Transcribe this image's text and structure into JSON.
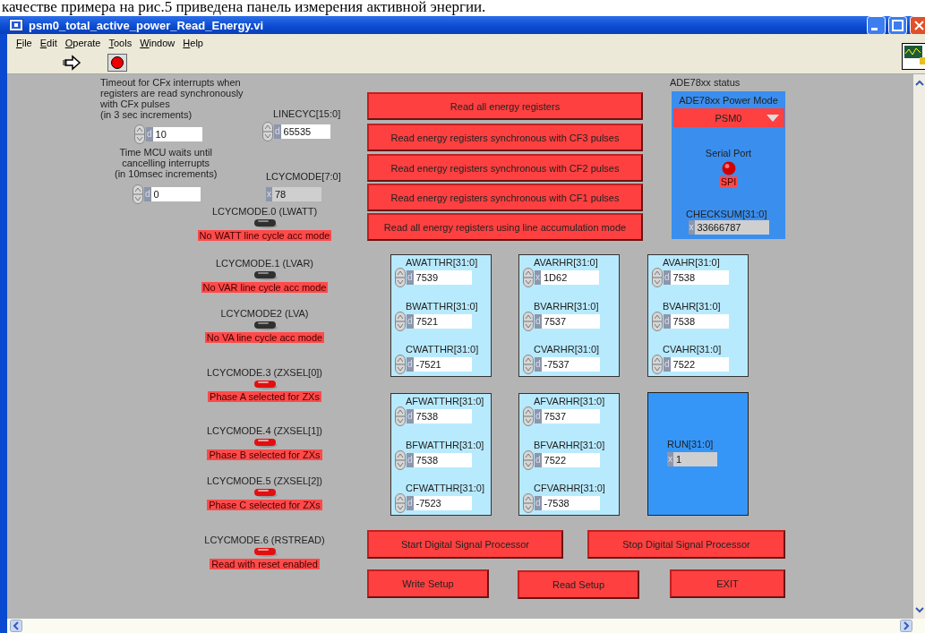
{
  "document_text": "качестве примера на рис.5 приведена панель измерения активной энергии.",
  "window": {
    "title": "psm0_total_active_power_Read_Energy.vi"
  },
  "menu": [
    "File",
    "Edit",
    "Operate",
    "Tools",
    "Window",
    "Help"
  ],
  "settings": [
    {
      "label": "Timeout for CFx interrupts when\n registers are read synchronously\n with CFx pulses\n(in 3 sec increments)",
      "radix": "d",
      "value": "10",
      "kind": "control"
    },
    {
      "label": "LINECYC[15:0]",
      "radix": "d",
      "value": "65535",
      "kind": "control"
    },
    {
      "label": "Time MCU waits until\ncancelling interrupts\n(in 10msec increments)",
      "radix": "d",
      "value": "0",
      "kind": "control"
    },
    {
      "label": "LCYCMODE[7:0]",
      "radix": "x",
      "value": "78",
      "kind": "indicator"
    }
  ],
  "switches": [
    {
      "label": "LCYCMODE.0 (LWATT)",
      "on": false,
      "status": "No WATT line cycle acc mode"
    },
    {
      "label": "LCYCMODE.1 (LVAR)",
      "on": false,
      "status": "No VAR line cycle acc mode"
    },
    {
      "label": "LCYCMODE2 (LVA)",
      "on": false,
      "status": "No VA line cycle acc mode"
    },
    {
      "label": "LCYCMODE.3 (ZXSEL[0])",
      "on": true,
      "status": "Phase A selected for ZXs"
    },
    {
      "label": "LCYCMODE.4 (ZXSEL[1])",
      "on": true,
      "status": "Phase B selected for ZXs"
    },
    {
      "label": "LCYCMODE.5 (ZXSEL[2])",
      "on": true,
      "status": "Phase C selected for ZXs"
    },
    {
      "label": "LCYCMODE.6 (RSTREAD)",
      "on": true,
      "status": "Read with reset enabled"
    }
  ],
  "actions": [
    "Read all energy registers",
    "Read energy registers synchronous with CF3 pulses",
    "Read energy registers synchronous with CF2 pulses",
    "Read energy registers synchronous with CF1 pulses",
    "Read all energy registers using line accumulation mode"
  ],
  "status": {
    "title": "ADE78xx status",
    "mode_label": "ADE78xx Power Mode",
    "mode": "PSM0",
    "port_label": "Serial Port",
    "port": "SPI",
    "checksum": {
      "label": "CHECKSUM[31:0]",
      "radix": "x",
      "value": "33666787"
    }
  },
  "register_groups": [
    [
      {
        "label": "AWATTHR[31:0]",
        "radix": "d",
        "value": "7539",
        "kind": "control"
      },
      {
        "label": "BWATTHR[31:0]",
        "radix": "d",
        "value": "7521",
        "kind": "control"
      },
      {
        "label": "CWATTHR[31:0]",
        "radix": "d",
        "value": "-7521",
        "kind": "control"
      }
    ],
    [
      {
        "label": "AVARHR[31:0]",
        "radix": "x",
        "value": "1D62",
        "kind": "control"
      },
      {
        "label": "BVARHR[31:0]",
        "radix": "d",
        "value": "7537",
        "kind": "control"
      },
      {
        "label": "CVARHR[31:0]",
        "radix": "d",
        "value": "-7537",
        "kind": "control"
      }
    ],
    [
      {
        "label": "AVAHR[31:0]",
        "radix": "d",
        "value": "7538",
        "kind": "control"
      },
      {
        "label": "BVAHR[31:0]",
        "radix": "d",
        "value": "7538",
        "kind": "control"
      },
      {
        "label": "CVAHR[31:0]",
        "radix": "d",
        "value": "7522",
        "kind": "control"
      }
    ],
    [
      {
        "label": "AFWATTHR[31:0]",
        "radix": "d",
        "value": "7538",
        "kind": "control"
      },
      {
        "label": "BFWATTHR[31:0]",
        "radix": "d",
        "value": "7538",
        "kind": "control"
      },
      {
        "label": "CFWATTHR[31:0]",
        "radix": "d",
        "value": "-7523",
        "kind": "control"
      }
    ],
    [
      {
        "label": "AFVARHR[31:0]",
        "radix": "d",
        "value": "7537",
        "kind": "control"
      },
      {
        "label": "BFVARHR[31:0]",
        "radix": "d",
        "value": "7522",
        "kind": "control"
      },
      {
        "label": "CFVARHR[31:0]",
        "radix": "d",
        "value": "-7538",
        "kind": "control"
      }
    ]
  ],
  "run": {
    "label": "RUN[31:0]",
    "radix": "x",
    "value": "1"
  },
  "buttons": [
    "Start Digital Signal Processor",
    "Stop Digital Signal Processor",
    "Write Setup",
    "Read Setup",
    "EXIT"
  ]
}
